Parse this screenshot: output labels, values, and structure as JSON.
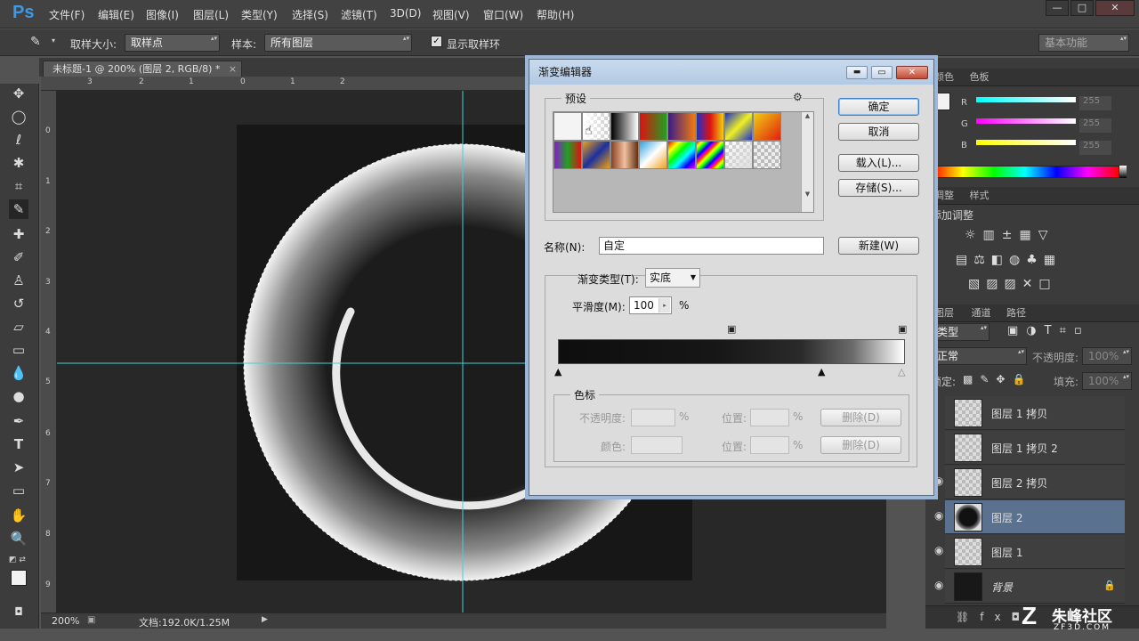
{
  "app": {
    "logo": "Ps",
    "menu": [
      "文件(F)",
      "编辑(E)",
      "图像(I)",
      "图层(L)",
      "类型(Y)",
      "选择(S)",
      "滤镜(T)",
      "3D(D)",
      "视图(V)",
      "窗口(W)",
      "帮助(H)"
    ],
    "window_buttons": [
      "—",
      "□",
      "✕"
    ]
  },
  "options": {
    "sample_size_label": "取样大小:",
    "sample_size_value": "取样点",
    "sample_label": "样本:",
    "sample_value": "所有图层",
    "show_ring_label": "显示取样环",
    "show_ring_checked": true,
    "workspace": "基本功能"
  },
  "document": {
    "tab_title": "未标题-1 @ 200% (图层 2, RGB/8) *",
    "zoom": "200%",
    "doc_size": "文档:192.0K/1.25M",
    "ruler_top": [
      "3",
      "2",
      "1",
      "0",
      "1",
      "2"
    ],
    "ruler_left": [
      "0",
      "1",
      "2",
      "3",
      "4",
      "5",
      "6",
      "7",
      "8",
      "9"
    ]
  },
  "gradient_editor": {
    "title": "渐变编辑器",
    "presets_label": "预设",
    "ok": "确定",
    "cancel": "取消",
    "load": "载入(L)...",
    "save": "存储(S)...",
    "name_label": "名称(N):",
    "name_value": "自定",
    "new_button": "新建(W)",
    "type_label": "渐变类型(T):",
    "type_value": "实底",
    "smooth_label": "平滑度(M):",
    "smooth_value": "100",
    "percent": "%",
    "stops_group": "色标",
    "opacity_label": "不透明度:",
    "position_label": "位置:",
    "color_label": "颜色:",
    "delete_label": "删除(D)"
  },
  "color_panel": {
    "tabs": [
      "颜色",
      "色板"
    ],
    "channels": [
      {
        "label": "R",
        "value": "255",
        "color": "#00ffff"
      },
      {
        "label": "G",
        "value": "255",
        "color": "#ff00ff"
      },
      {
        "label": "B",
        "value": "255",
        "color": "#ffff00"
      }
    ]
  },
  "adjust_panel": {
    "tabs": [
      "调整",
      "样式"
    ],
    "title": "添加调整"
  },
  "layers_panel": {
    "tabs": [
      "图层",
      "通道",
      "路径"
    ],
    "filter": "类型",
    "blend": "正常",
    "opacity_label": "不透明度:",
    "opacity_value": "100%",
    "lock_label": "锁定:",
    "fill_label": "填充:",
    "fill_value": "100%",
    "layers": [
      {
        "name": "图层 1 拷贝",
        "visible": false,
        "selected": false
      },
      {
        "name": "图层 1 拷贝 2",
        "visible": false,
        "selected": false
      },
      {
        "name": "图层 2 拷贝",
        "visible": true,
        "selected": false
      },
      {
        "name": "图层 2",
        "visible": true,
        "selected": true
      },
      {
        "name": "图层 1",
        "visible": true,
        "selected": false
      },
      {
        "name": "背景",
        "visible": true,
        "selected": false
      }
    ]
  },
  "watermark": {
    "brand": "朱峰社区",
    "url": "ZF3D.COM"
  }
}
